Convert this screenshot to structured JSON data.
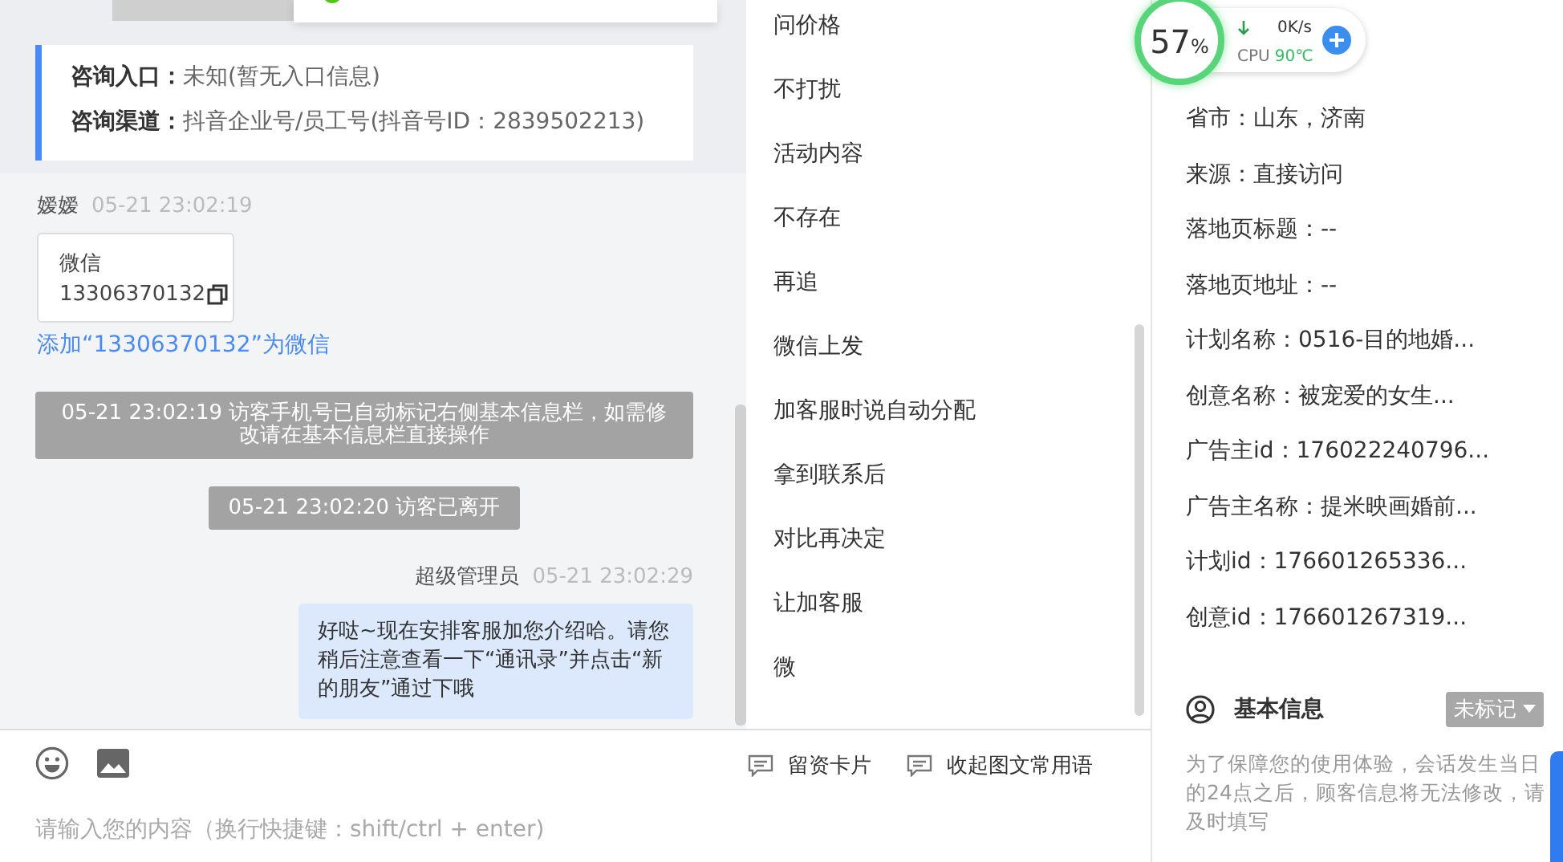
{
  "consult_card": {
    "rows": [
      {
        "label": "咨询入口：",
        "value": "未知(暂无入口信息)"
      },
      {
        "label": "咨询渠道：",
        "value": "抖音企业号/员工号(抖音号ID：2839502213)"
      }
    ]
  },
  "messages": [
    {
      "kind": "card",
      "sender": "嫒嫒",
      "time": "05-21 23:02:19",
      "card_title": "微信",
      "card_number": "13306370132",
      "link": "添加“13306370132”为微信"
    },
    {
      "kind": "system",
      "text": "05-21 23:02:19 访客手机号已自动标记右侧基本信息栏，如需修改请在基本信息栏直接操作"
    },
    {
      "kind": "system",
      "text": "05-21 23:02:20 访客已离开"
    },
    {
      "kind": "outgoing",
      "sender": "超级管理员",
      "time": "05-21 23:02:29",
      "text": "好哒~现在安排客服加您介绍哈。请您稍后注意查看一下“通讯录”并点击“新的朋友”通过下哦"
    }
  ],
  "composer": {
    "placeholder": "请输入您的内容（换行快捷键：shift/ctrl + enter)"
  },
  "quick_replies": [
    "问价格",
    "不打扰",
    "活动内容",
    "不存在",
    "再追",
    "微信上发",
    "加客服时说自动分配",
    "拿到联系后",
    "对比再决定",
    "让加客服",
    "微"
  ],
  "quick_actions": [
    "留资卡片",
    "收起图文常用语"
  ],
  "source_info": [
    "省市：山东，济南",
    "来源：直接访问",
    "落地页标题：--",
    "落地页地址：--",
    "计划名称：0516-目的地婚...",
    "创意名称：被宠爱的女生...",
    "广告主id：176022240796...",
    "广告主名称：提米映画婚前...",
    "计划id：176601265336...",
    "创意id：176601267319..."
  ],
  "basic_info": {
    "title": "基本信息",
    "tag": "未标记",
    "note": "为了保障您的使用体验，会话发生当日的24点之后，顾客信息将无法修改，请及时填写"
  },
  "monitor": {
    "percent": "57",
    "unit": "%",
    "speed": "0K/s",
    "cpu_label": "CPU",
    "cpu_temp": "90℃"
  }
}
